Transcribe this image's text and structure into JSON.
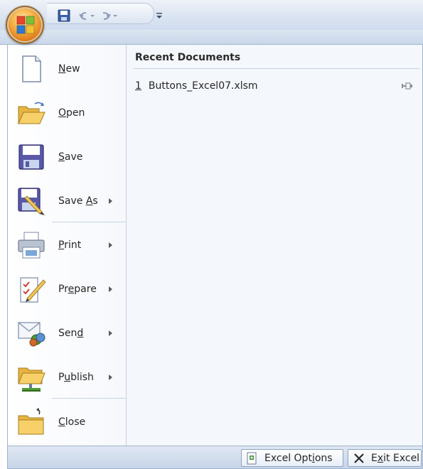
{
  "quick_access": {
    "icons": [
      "save-icon",
      "undo-icon",
      "redo-icon",
      "customize-icon"
    ]
  },
  "menu": {
    "items": [
      {
        "label": "New",
        "icon": "new-document-icon",
        "accel": "N",
        "has_submenu": false
      },
      {
        "label": "Open",
        "icon": "open-folder-icon",
        "accel": "O",
        "has_submenu": false
      },
      {
        "label": "Save",
        "icon": "save-disk-icon",
        "accel": "S",
        "has_submenu": false
      },
      {
        "label": "Save As",
        "icon": "save-as-icon",
        "accel": "A",
        "has_submenu": true
      },
      {
        "label": "Print",
        "icon": "printer-icon",
        "accel": "P",
        "has_submenu": true
      },
      {
        "label": "Prepare",
        "icon": "prepare-icon",
        "accel": "e",
        "has_submenu": true
      },
      {
        "label": "Send",
        "icon": "send-icon",
        "accel": "d",
        "has_submenu": true
      },
      {
        "label": "Publish",
        "icon": "publish-icon",
        "accel": "u",
        "has_submenu": true
      },
      {
        "label": "Close",
        "icon": "close-folder-icon",
        "accel": "C",
        "has_submenu": false
      }
    ]
  },
  "recent": {
    "header": "Recent Documents",
    "documents": [
      {
        "num": "1",
        "name": "Buttons_Excel07.xlsm"
      }
    ]
  },
  "footer": {
    "options_label": "Excel Options",
    "exit_label": "Exit Excel"
  }
}
